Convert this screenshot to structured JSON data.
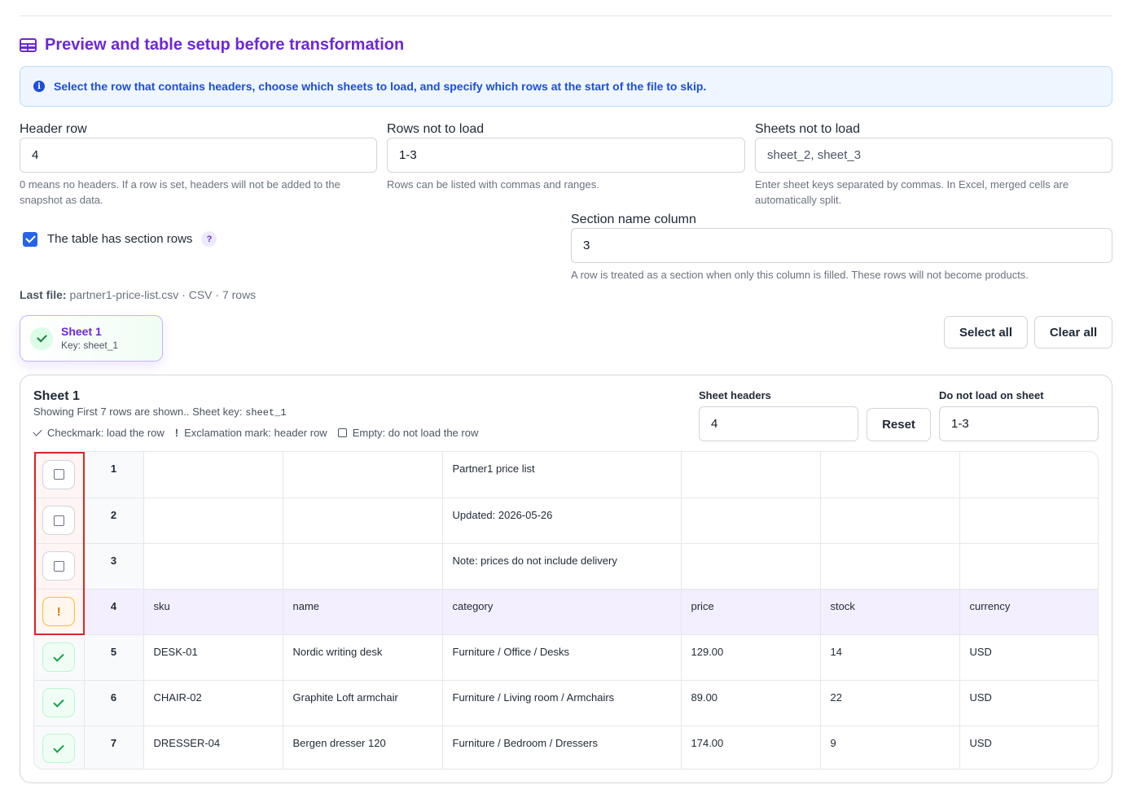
{
  "title": "Preview and table setup before transformation",
  "info": "Select the row that contains headers, choose which sheets to load, and specify which rows at the start of the file to skip.",
  "fields": {
    "header_row": {
      "label": "Header row",
      "value": "4",
      "help": "0 means no headers. If a row is set, headers will not be added to the snapshot as data."
    },
    "rows_skip": {
      "label": "Rows not to load",
      "value": "1-3",
      "help": "Rows can be listed with commas and ranges."
    },
    "sheets_skip": {
      "label": "Sheets not to load",
      "placeholder": "sheet_2, sheet_3",
      "help": "Enter sheet keys separated by commas. In Excel, merged cells are automatically split."
    },
    "section_col": {
      "label": "Section name column",
      "value": "3",
      "help": "A row is treated as a section when only this column is filled. These rows will not become products."
    }
  },
  "section_rows": {
    "label": "The table has section rows",
    "help_badge": "?"
  },
  "last_file": {
    "label": "Last file:",
    "value": "partner1-price-list.csv · CSV · 7 rows"
  },
  "sheet_chip": {
    "name": "Sheet 1",
    "key": "Key: sheet_1"
  },
  "buttons": {
    "select_all": "Select all",
    "clear_all": "Clear all",
    "reset": "Reset"
  },
  "panel": {
    "title": "Sheet 1",
    "subtitle": "Showing First 7 rows are shown.. Sheet key:",
    "sheet_key": "sheet_1",
    "legend": {
      "load": "Checkmark: load the row",
      "header": "Exclamation mark: header row",
      "skip": "Empty: do not load the row"
    },
    "sheet_headers_label": "Sheet headers",
    "sheet_headers_value": "4",
    "skip_label": "Do not load on sheet",
    "skip_value": "1-3"
  },
  "rows": [
    {
      "n": "1",
      "state": "empty",
      "cells": [
        "",
        "",
        "Partner1 price list",
        "",
        "",
        ""
      ]
    },
    {
      "n": "2",
      "state": "empty",
      "cells": [
        "",
        "",
        "Updated: 2026-05-26",
        "",
        "",
        ""
      ]
    },
    {
      "n": "3",
      "state": "empty",
      "cells": [
        "",
        "",
        "Note: prices do not include delivery",
        "",
        "",
        ""
      ]
    },
    {
      "n": "4",
      "state": "header",
      "cells": [
        "sku",
        "name",
        "category",
        "price",
        "stock",
        "currency"
      ]
    },
    {
      "n": "5",
      "state": "load",
      "cells": [
        "DESK-01",
        "Nordic writing desk",
        "Furniture / Office / Desks",
        "129.00",
        "14",
        "USD"
      ]
    },
    {
      "n": "6",
      "state": "load",
      "cells": [
        "CHAIR-02",
        "Graphite Loft armchair",
        "Furniture / Living room / Armchairs",
        "89.00",
        "22",
        "USD"
      ]
    },
    {
      "n": "7",
      "state": "load",
      "cells": [
        "DRESSER-04",
        "Bergen dresser 120",
        "Furniture / Bedroom / Dressers",
        "174.00",
        "9",
        "USD"
      ]
    }
  ],
  "colors": {
    "accent": "#6d28d9",
    "info": "#1d4ed8",
    "highlight": "#dc2626"
  }
}
